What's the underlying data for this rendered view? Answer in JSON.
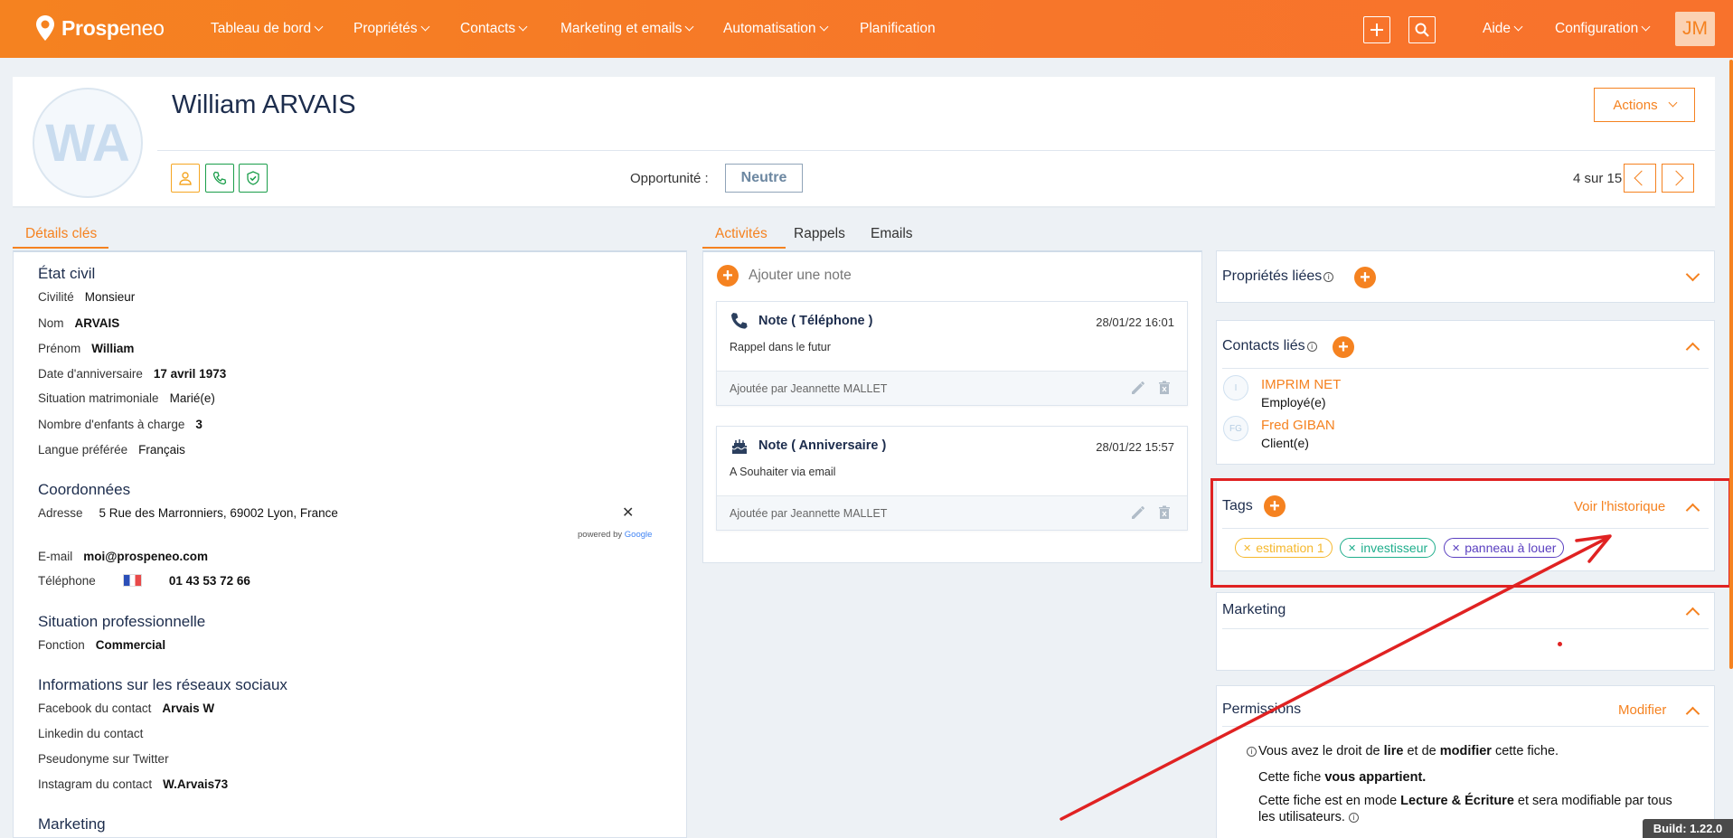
{
  "app": {
    "brand": "Prospeneo",
    "brand_parts": [
      "Prosp",
      "eneo"
    ],
    "accent_color": "#f58220",
    "user_initials": "JM",
    "build": "Build: 1.22.0"
  },
  "nav": {
    "items": [
      {
        "label": "Tableau de bord",
        "has_dropdown": true
      },
      {
        "label": "Propriétés",
        "has_dropdown": true
      },
      {
        "label": "Contacts",
        "has_dropdown": true
      },
      {
        "label": "Marketing et emails",
        "has_dropdown": true
      },
      {
        "label": "Automatisation",
        "has_dropdown": true
      },
      {
        "label": "Planification",
        "has_dropdown": false
      }
    ],
    "right": [
      {
        "label": "Aide",
        "has_dropdown": true
      },
      {
        "label": "Configuration",
        "has_dropdown": true
      }
    ],
    "icons": [
      "plus-icon",
      "search-icon"
    ]
  },
  "header": {
    "initials": "WA",
    "name": "William ARVAIS",
    "actions_label": "Actions",
    "opportunity_label": "Opportunité :",
    "opportunity_value": "Neutre",
    "pager": "4 sur 15",
    "icons": [
      "person-icon",
      "phone-icon",
      "shield-check-icon"
    ]
  },
  "tabs": {
    "left": [
      "Détails clés"
    ],
    "middle": [
      "Activités",
      "Rappels",
      "Emails"
    ]
  },
  "details": {
    "etat_civil": {
      "title": "État civil",
      "fields": [
        {
          "label": "Civilité",
          "value": "Monsieur"
        },
        {
          "label": "Nom",
          "value": "ARVAIS"
        },
        {
          "label": "Prénom",
          "value": "William"
        },
        {
          "label": "Date d'anniversaire",
          "value": "17 avril 1973"
        },
        {
          "label": "Situation matrimoniale",
          "value": "Marié(e)"
        },
        {
          "label": "Nombre d'enfants à charge",
          "value": "3"
        },
        {
          "label": "Langue préférée",
          "value": "Français"
        }
      ]
    },
    "coordonnees": {
      "title": "Coordonnées",
      "address_label": "Adresse",
      "address_value": "5 Rue des Marronniers, 69002 Lyon, France",
      "powered_by": "powered by",
      "google": "Google",
      "email_label": "E-mail",
      "email_value": "moi@prospeneo.com",
      "phone_label": "Téléphone",
      "phone_value": "01 43 53 72 66"
    },
    "situation_pro": {
      "title": "Situation professionnelle",
      "fonction_label": "Fonction",
      "fonction_value": "Commercial"
    },
    "reseaux": {
      "title": "Informations sur les réseaux sociaux",
      "fields": [
        {
          "label": "Facebook du contact",
          "value": "Arvais W"
        },
        {
          "label": "Linkedin du contact",
          "value": ""
        },
        {
          "label": "Pseudonyme sur Twitter",
          "value": ""
        },
        {
          "label": "Instagram du contact",
          "value": "W.Arvais73"
        }
      ]
    },
    "marketing_title": "Marketing"
  },
  "activities": {
    "add_note": "Ajouter une note",
    "notes": [
      {
        "title": "Note ( Téléphone )",
        "date": "28/01/22 16:01",
        "body": "Rappel dans le futur",
        "author": "Ajoutée par Jeannette MALLET",
        "icon": "phone-icon"
      },
      {
        "title": "Note ( Anniversaire )",
        "date": "28/01/22 15:57",
        "body": "A Souhaiter via email",
        "author": "Ajoutée par Jeannette MALLET",
        "icon": "cake-icon"
      }
    ]
  },
  "panels": {
    "proprietes": {
      "title": "Propriétés liées"
    },
    "contacts": {
      "title": "Contacts liés",
      "items": [
        {
          "initials": "I",
          "name": "IMPRIM NET",
          "role": "Employé(e)"
        },
        {
          "initials": "FG",
          "name": "Fred GIBAN",
          "role": "Client(e)"
        }
      ]
    },
    "tags": {
      "title": "Tags",
      "history_link": "Voir l'historique",
      "items": [
        {
          "label": "estimation 1",
          "color": "#f5b82e"
        },
        {
          "label": "investisseur",
          "color": "#1fae8c"
        },
        {
          "label": "panneau à louer",
          "color": "#5a3fc0"
        }
      ]
    },
    "marketing": {
      "title": "Marketing"
    },
    "permissions": {
      "title": "Permissions",
      "modify_link": "Modifier",
      "line1_a": "Vous avez le droit de ",
      "line1_b": "lire",
      "line1_c": " et de ",
      "line1_d": "modifier",
      "line1_e": " cette fiche.",
      "line2_a": "Cette fiche ",
      "line2_b": "vous appartient.",
      "line3_a": "Cette fiche est en mode ",
      "line3_b": "Lecture & Écriture",
      "line3_c": " et sera modifiable par tous",
      "line4": "les utilisateurs."
    }
  },
  "annotation_color": "#e02222"
}
